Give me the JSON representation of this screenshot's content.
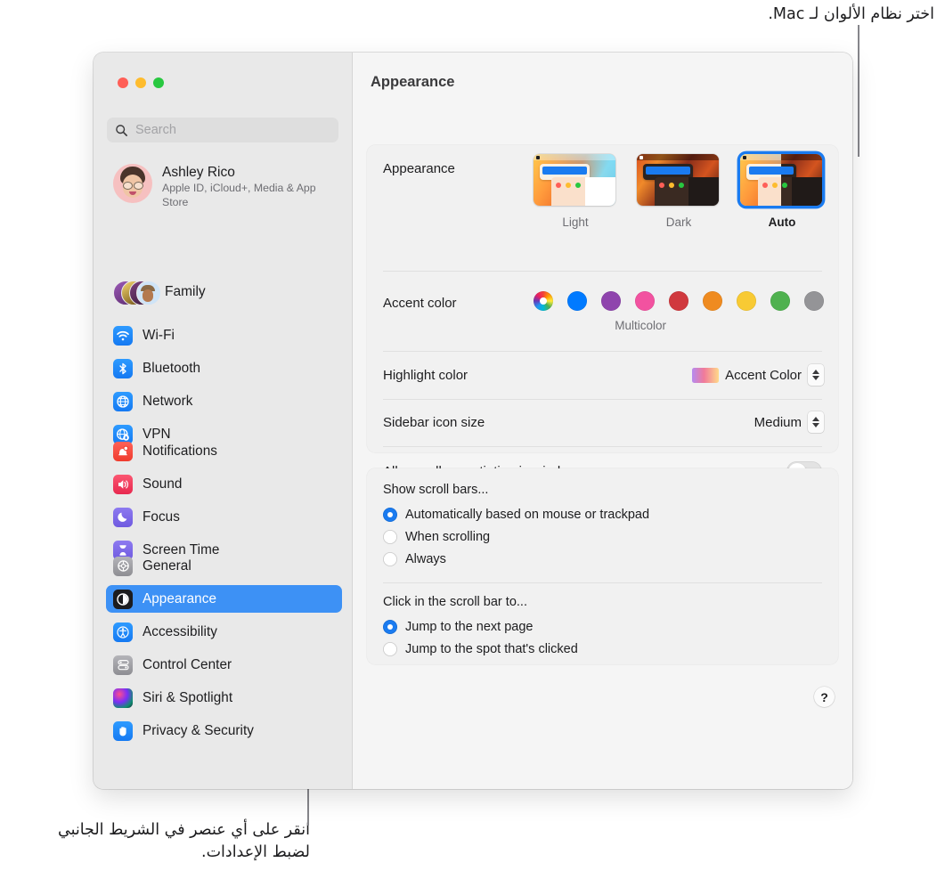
{
  "annotations": {
    "top": "اختر نظام الألوان لـ Mac.",
    "bottom": "انقر على أي عنصر في الشريط الجانبي لضبط الإعدادات."
  },
  "window": {
    "traffic_lights": [
      "close-red",
      "minimize-yellow",
      "zoom-green"
    ]
  },
  "sidebar": {
    "search": {
      "placeholder": "Search",
      "icon": "search-icon"
    },
    "account": {
      "name": "Ashley Rico",
      "subtitle": "Apple ID, iCloud+, Media & App Store"
    },
    "family": {
      "label": "Family"
    },
    "groups": [
      {
        "items": [
          {
            "label": "Wi-Fi",
            "icon": "wifi-icon"
          },
          {
            "label": "Bluetooth",
            "icon": "bluetooth-icon"
          },
          {
            "label": "Network",
            "icon": "network-globe-icon"
          },
          {
            "label": "VPN",
            "icon": "vpn-globe-icon"
          }
        ]
      },
      {
        "items": [
          {
            "label": "Notifications",
            "icon": "bell-icon"
          },
          {
            "label": "Sound",
            "icon": "speaker-icon"
          },
          {
            "label": "Focus",
            "icon": "moon-icon"
          },
          {
            "label": "Screen Time",
            "icon": "hourglass-icon"
          }
        ]
      },
      {
        "items": [
          {
            "label": "General",
            "icon": "gear-icon"
          },
          {
            "label": "Appearance",
            "icon": "appearance-contrast-icon",
            "selected": true
          },
          {
            "label": "Accessibility",
            "icon": "accessibility-person-icon"
          },
          {
            "label": "Control Center",
            "icon": "control-center-icon"
          },
          {
            "label": "Siri & Spotlight",
            "icon": "siri-orb-icon"
          },
          {
            "label": "Privacy & Security",
            "icon": "hand-icon"
          }
        ]
      }
    ]
  },
  "detail": {
    "title": "Appearance",
    "appearance_row": {
      "label": "Appearance",
      "options": [
        {
          "label": "Light",
          "selected": false
        },
        {
          "label": "Dark",
          "selected": false
        },
        {
          "label": "Auto",
          "selected": true
        }
      ]
    },
    "accent_row": {
      "label": "Accent color",
      "caption": "Multicolor",
      "swatches": [
        {
          "name": "multicolor",
          "color": "multicolor",
          "selected": true
        },
        {
          "name": "blue",
          "color": "#007aff"
        },
        {
          "name": "purple",
          "color": "#8f44ad"
        },
        {
          "name": "pink",
          "color": "#f252a0"
        },
        {
          "name": "red",
          "color": "#d0393e"
        },
        {
          "name": "orange",
          "color": "#ef8b20"
        },
        {
          "name": "yellow",
          "color": "#f8ca34"
        },
        {
          "name": "green",
          "color": "#4fb14f"
        },
        {
          "name": "graphite",
          "color": "#949497"
        }
      ]
    },
    "highlight_row": {
      "label": "Highlight color",
      "value": "Accent Color"
    },
    "sidebar_size_row": {
      "label": "Sidebar icon size",
      "value": "Medium"
    },
    "tinting_row": {
      "label": "Allow wallpaper tinting in windows",
      "enabled": false
    },
    "scrollbars": {
      "title": "Show scroll bars...",
      "options": [
        {
          "label": "Automatically based on mouse or trackpad",
          "selected": true
        },
        {
          "label": "When scrolling",
          "selected": false
        },
        {
          "label": "Always",
          "selected": false
        }
      ]
    },
    "scrollclick": {
      "title": "Click in the scroll bar to...",
      "options": [
        {
          "label": "Jump to the next page",
          "selected": true
        },
        {
          "label": "Jump to the spot that's clicked",
          "selected": false
        }
      ]
    },
    "help_button": {
      "label": "?"
    }
  }
}
